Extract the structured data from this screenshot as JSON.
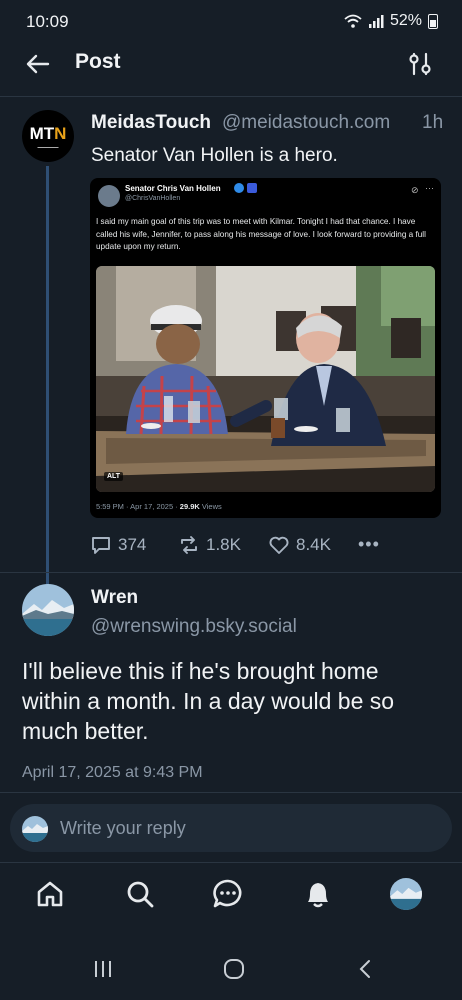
{
  "status": {
    "time": "10:09",
    "battery": "52%"
  },
  "header": {
    "title": "Post"
  },
  "post": {
    "author_name": "MeidasTouch",
    "author_handle": "@meidastouch.com",
    "time": "1h",
    "text": "Senator Van Hollen is a hero.",
    "avatar_logo": "MTN",
    "embed": {
      "name": "Senator Chris Van Hollen",
      "handle": "@ChrisVanHollen",
      "text": "I said my main goal of this trip was to meet with Kilmar. Tonight I had that chance. I have called his wife, Jennifer, to pass along his message of love. I look forward to providing a full update upon my return.",
      "alt_label": "ALT",
      "meta_time": "5:59 PM · Apr 17, 2025 · ",
      "meta_views": "29.9K",
      "meta_views_label": " Views"
    },
    "actions": {
      "replies": "374",
      "reposts": "1.8K",
      "likes": "8.4K"
    }
  },
  "reply": {
    "author_name": "Wren",
    "author_handle": "@wrenswing.bsky.social",
    "text": "I'll believe this if he's brought home within a month. In a day would be so much better.",
    "timestamp": "April 17, 2025 at 9:43 PM"
  },
  "composer": {
    "placeholder": "Write your reply"
  },
  "colors": {
    "background": "#161e27",
    "accent": "#2f4f74",
    "muted": "#8a97a6"
  },
  "icons": [
    "back-arrow-icon",
    "filter-sliders-icon",
    "reply-icon",
    "repost-icon",
    "heart-icon",
    "more-icon",
    "home-icon",
    "search-icon",
    "chat-icon",
    "bell-icon"
  ]
}
